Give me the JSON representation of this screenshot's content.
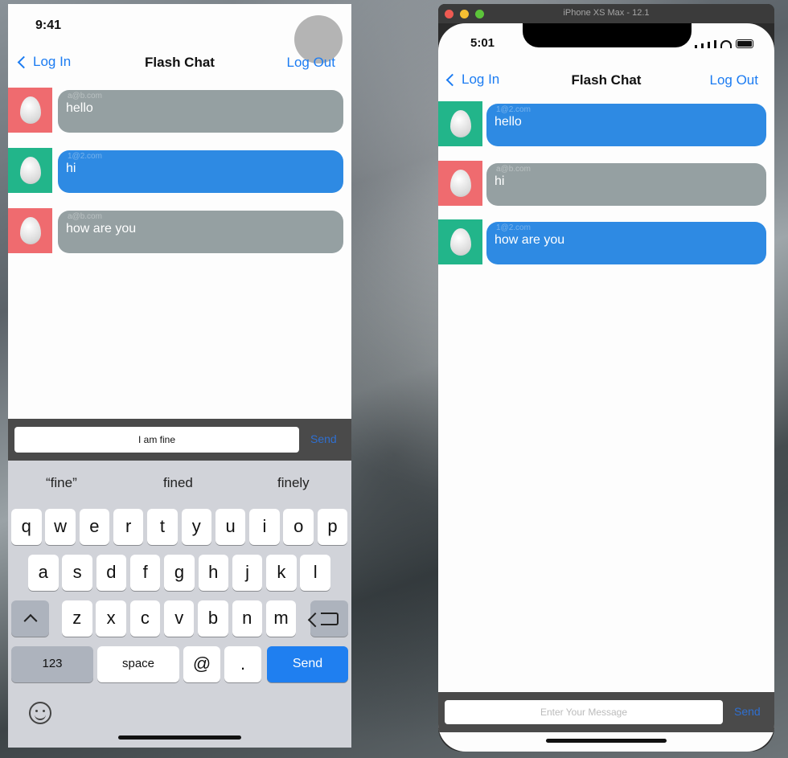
{
  "left_phone": {
    "status": {
      "time": "9:41"
    },
    "nav": {
      "back_label": "Log In",
      "title": "Flash Chat",
      "right_label": "Log Out"
    },
    "messages": [
      {
        "sender": "a@b.com",
        "text": "hello",
        "avatar_color": "#ef6b6f",
        "bubble_color": "#95a0a2"
      },
      {
        "sender": "1@2.com",
        "text": "hi",
        "avatar_color": "#22b58a",
        "bubble_color": "#2e8ae3"
      },
      {
        "sender": "a@b.com",
        "text": "how are you",
        "avatar_color": "#ef6b6f",
        "bubble_color": "#95a0a2"
      }
    ],
    "input": {
      "value": "I am fine",
      "send_label": "Send"
    },
    "keyboard": {
      "predictions": [
        "“fine”",
        "fined",
        "finely"
      ],
      "row1": [
        "q",
        "w",
        "e",
        "r",
        "t",
        "y",
        "u",
        "i",
        "o",
        "p"
      ],
      "row2": [
        "a",
        "s",
        "d",
        "f",
        "g",
        "h",
        "j",
        "k",
        "l"
      ],
      "row3": [
        "z",
        "x",
        "c",
        "v",
        "b",
        "n",
        "m"
      ],
      "numbers_key": "123",
      "space_key": "space",
      "at_key": "@",
      "dot_key": ".",
      "send_key": "Send"
    }
  },
  "simulator": {
    "window_title": "iPhone XS Max - 12.1",
    "status": {
      "time": "5:01"
    },
    "nav": {
      "back_label": "Log In",
      "title": "Flash Chat",
      "right_label": "Log Out"
    },
    "messages": [
      {
        "sender": "1@2.com",
        "text": "hello",
        "avatar_color": "#22b58a",
        "bubble_color": "#2e8ae3"
      },
      {
        "sender": "a@b.com",
        "text": "hi",
        "avatar_color": "#ef6b6f",
        "bubble_color": "#95a0a2"
      },
      {
        "sender": "1@2.com",
        "text": "how are you",
        "avatar_color": "#22b58a",
        "bubble_color": "#2e8ae3"
      }
    ],
    "input": {
      "placeholder": "Enter Your Message",
      "send_label": "Send"
    }
  },
  "colors": {
    "accent": "#1c7cf2",
    "send_key": "#1f7ff0"
  }
}
